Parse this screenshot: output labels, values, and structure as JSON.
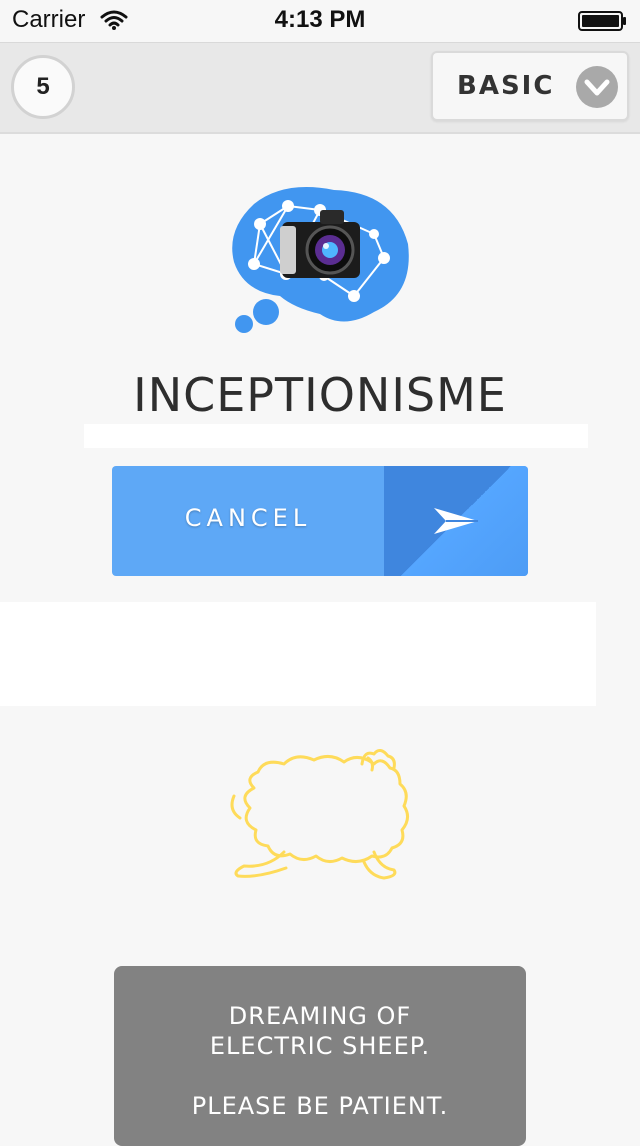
{
  "status_bar": {
    "carrier": "Carrier",
    "time": "4:13 PM",
    "icons": [
      "wifi-icon",
      "battery-icon"
    ]
  },
  "toolbar": {
    "count": "5",
    "mode_label": "BASIC",
    "mode_icon": "chevron-down-icon"
  },
  "app": {
    "logo_icon": "brain-camera-logo",
    "title": "INCEPTIONISME"
  },
  "action": {
    "cancel_label": "CANCEL",
    "send_icon": "send-icon"
  },
  "loading": {
    "icon": "sheep-icon",
    "line1": "DREAMING OF",
    "line2": "ELECTRIC SHEEP.",
    "line3": "PLEASE BE PATIENT."
  },
  "colors": {
    "accent_blue": "#5ea8f6",
    "accent_blue_dark": "#3f86de",
    "sheep_outline": "#ffd84a",
    "message_bg": "#828282"
  }
}
